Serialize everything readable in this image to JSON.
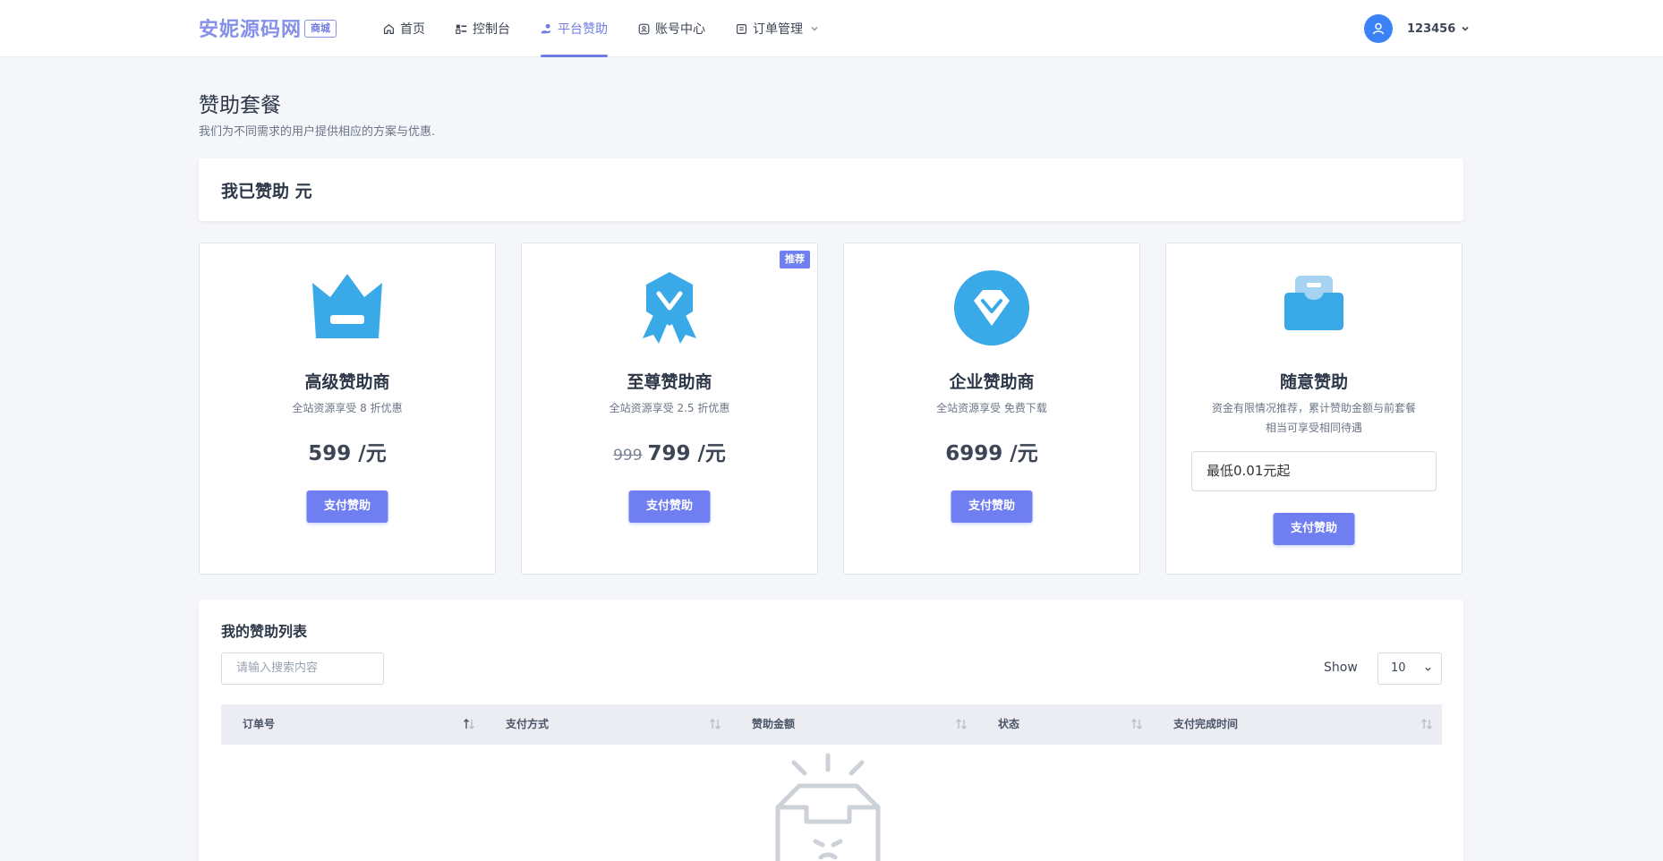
{
  "header": {
    "brand": "安妮源码网",
    "brand_badge": "商城",
    "nav": [
      {
        "label": "首页",
        "icon": "home-icon"
      },
      {
        "label": "控制台",
        "icon": "dashboard-icon"
      },
      {
        "label": "平台赞助",
        "icon": "hand-coin-icon",
        "active": true
      },
      {
        "label": "账号中心",
        "icon": "user-circle-icon"
      },
      {
        "label": "订单管理",
        "icon": "order-icon",
        "dropdown": true
      }
    ],
    "username": "123456"
  },
  "page": {
    "title": "赞助套餐",
    "subtitle": "我们为不同需求的用户提供相应的方案与优惠."
  },
  "sponsored": {
    "label": "我已赞助 元"
  },
  "plans": [
    {
      "name": "高级赞助商",
      "desc": "全站资源享受 8 折优惠",
      "price": "599 /元",
      "old_price": "",
      "button": "支付赞助",
      "icon": "crown-icon"
    },
    {
      "name": "至尊赞助商",
      "desc": "全站资源享受 2.5 折优惠",
      "price": "799 /元",
      "old_price": "999",
      "button": "支付赞助",
      "icon": "medal-icon",
      "ribbon": "推荐"
    },
    {
      "name": "企业赞助商",
      "desc": "全站资源享受 免费下载",
      "price": "6999 /元",
      "old_price": "",
      "button": "支付赞助",
      "icon": "diamond-icon"
    },
    {
      "name": "随意赞助",
      "desc": "资金有限情况推荐，累计赞助金额与前套餐相当可享受相同待遇",
      "amount_placeholder": "最低0.01元起",
      "button": "支付赞助",
      "icon": "wallet-icon"
    }
  ],
  "list": {
    "title": "我的赞助列表",
    "search_placeholder": "请输入搜索内容",
    "show_label": "Show",
    "page_size": "10",
    "columns": [
      "订单号",
      "支付方式",
      "赞助金额",
      "状态",
      "支付完成时间"
    ]
  },
  "colors": {
    "brand": "#8590e8",
    "accent": "#6f7ef0",
    "icon_blue": "#3aa9e8"
  }
}
